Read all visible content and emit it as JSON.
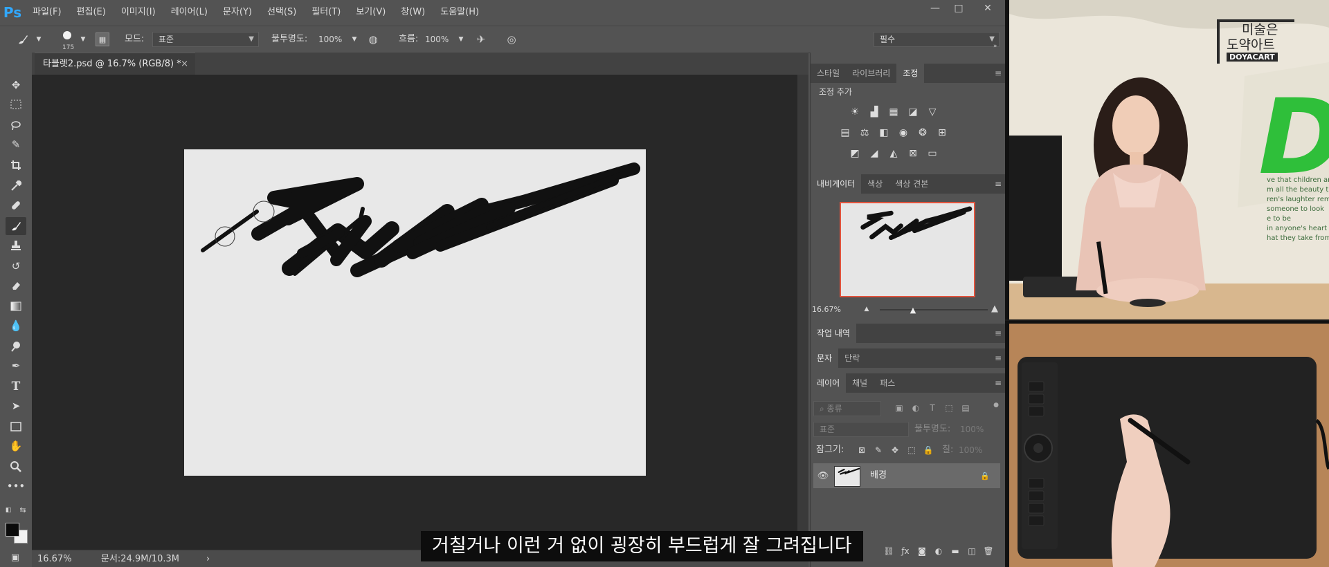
{
  "app": {
    "logo_text": "Ps"
  },
  "menu": [
    "파일(F)",
    "편집(E)",
    "이미지(I)",
    "레이어(L)",
    "문자(Y)",
    "선택(S)",
    "필터(T)",
    "보기(V)",
    "창(W)",
    "도움말(H)"
  ],
  "window_controls": [
    "—",
    "□",
    "✕"
  ],
  "options": {
    "brush_size": "175",
    "mode_label": "모드:",
    "mode_value": "표준",
    "opacity_label": "불투명도:",
    "opacity_value": "100%",
    "flow_label": "흐름:",
    "flow_value": "100%",
    "workspace": "필수"
  },
  "document_tab": {
    "title": "타블렛2.psd @ 16.7% (RGB/8) *",
    "close": "×"
  },
  "status": {
    "zoom": "16.67%",
    "doc_info": "문서:24.9M/10.3M",
    "arrow": "›"
  },
  "panels": {
    "adjust_tabs": [
      "스타일",
      "라이브러리",
      "조정"
    ],
    "adjust_title": "조정 추가",
    "nav_tabs": [
      "내비게이터",
      "색상",
      "색상 견본"
    ],
    "nav_zoom": "16.67%",
    "history_tab": "작업 내역",
    "char_tabs": [
      "문자",
      "단락"
    ],
    "layer_tabs": [
      "레이어",
      "채널",
      "패스"
    ],
    "layer_filter": "종류",
    "blend_mode": "표준",
    "layer_opacity_label": "불투명도:",
    "layer_opacity_value": "100%",
    "lock_label": "잠그기:",
    "fill_label": "칠:",
    "fill_value": "100%",
    "layer_name": "배경",
    "menu_icon": "≡"
  },
  "webcam": {
    "logo_line1": "미술은",
    "logo_line2": "도약아트",
    "logo_line3": "DOYACART",
    "wall_text": [
      "ve that children are our",
      "m all the beauty they",
      "ren's laughter remen",
      "someone to look",
      "e to be",
      "in anyone's heart",
      "hat they take from"
    ]
  },
  "subtitle": "거칠거나 이런 거 없이 굉장히 부드럽게 잘 그려집니다"
}
